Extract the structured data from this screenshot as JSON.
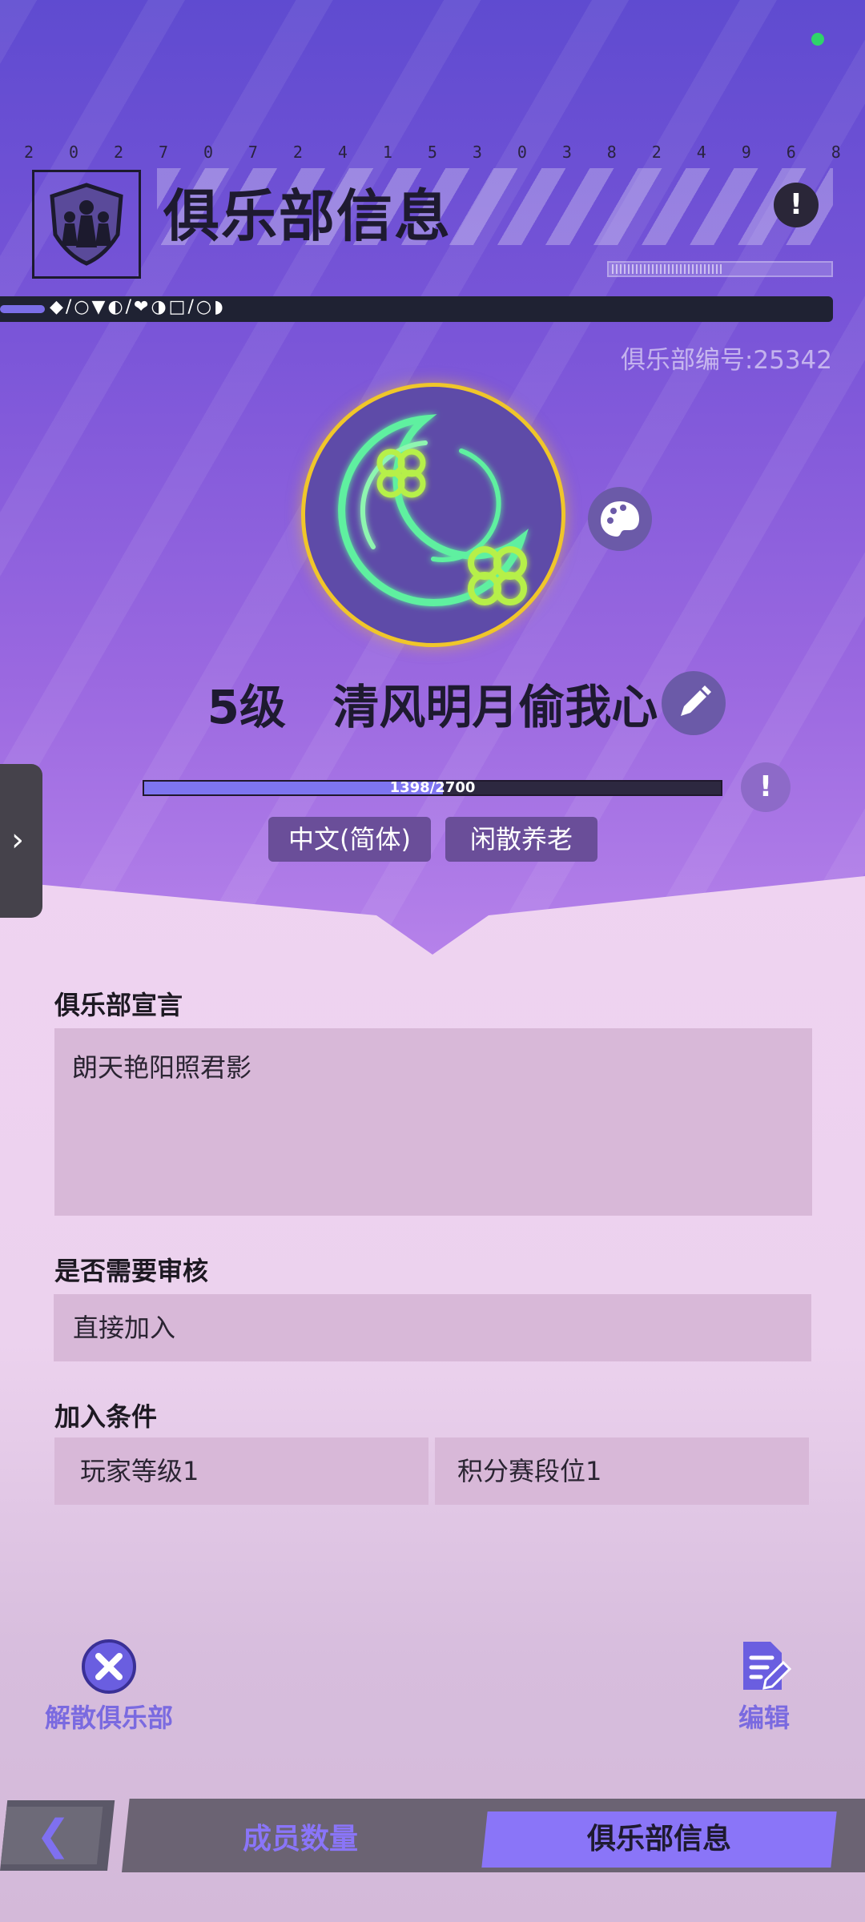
{
  "header": {
    "digits": [
      "2",
      "0",
      "2",
      "7",
      "0",
      "7",
      "2",
      "4",
      "1",
      "5",
      "3",
      "0",
      "3",
      "8",
      "2",
      "4",
      "9",
      "6",
      "8"
    ],
    "title": "俱乐部信息",
    "info_icon": "exclamation-icon",
    "ticker": "◆/○▼◐/❤◑□/○◗",
    "club_id": "俱乐部编号:25342"
  },
  "club": {
    "level": "5级",
    "name": "清风明月偷我心",
    "xp_current": 1398,
    "xp_max": 2700,
    "xp_text": "1398/2700",
    "tags": [
      "中文(简体)",
      "闲散养老"
    ]
  },
  "sections": {
    "declaration_label": "俱乐部宣言",
    "declaration_text": "朗天艳阳照君影",
    "review_label": "是否需要审核",
    "review_value": "直接加入",
    "conditions_label": "加入条件",
    "conditions": [
      "玩家等级1",
      "积分赛段位1"
    ]
  },
  "actions": {
    "disband_label": "解散俱乐部",
    "edit_label": "编辑"
  },
  "nav": {
    "back_glyph": "❮",
    "tabs": [
      "成员数量",
      "俱乐部信息"
    ],
    "active_tab": "俱乐部信息"
  },
  "side_tab_glyph": "›",
  "colors": {
    "accent": "#8a75f8",
    "logo_ring": "#f0c62a",
    "moon_neon": "#5ef0a0",
    "clover_neon": "#b6f04a",
    "status_dot": "#2fd36a"
  }
}
